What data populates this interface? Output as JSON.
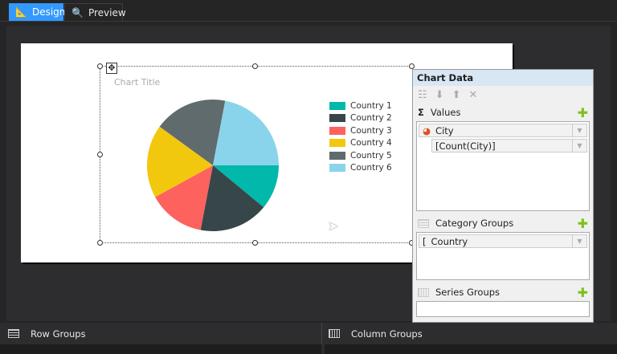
{
  "tabs": [
    {
      "label": "Design",
      "active": true,
      "icon": "design-ruler-icon"
    },
    {
      "label": "Preview",
      "active": false,
      "icon": "preview-icon"
    }
  ],
  "chart": {
    "title": "Chart Title"
  },
  "chart_data": {
    "type": "pie",
    "title": "Chart Title",
    "categories": [
      "Country 1",
      "Country 2",
      "Country 3",
      "Country 4",
      "Country 5",
      "Country 6"
    ],
    "values": [
      11,
      17,
      14,
      18,
      18,
      22
    ],
    "colors": [
      "#01b8aa",
      "#374649",
      "#fd625e",
      "#f2c80f",
      "#5f6b6d",
      "#8ad4eb"
    ],
    "legend": "right"
  },
  "panel": {
    "title": "Chart Data",
    "values": {
      "label": "Values",
      "field": "City",
      "expression": "[Count(City)]"
    },
    "category_groups": {
      "label": "Category Groups",
      "field": "Country"
    },
    "series_groups": {
      "label": "Series Groups"
    }
  },
  "bottom": {
    "row_groups": "Row Groups",
    "column_groups": "Column Groups"
  }
}
